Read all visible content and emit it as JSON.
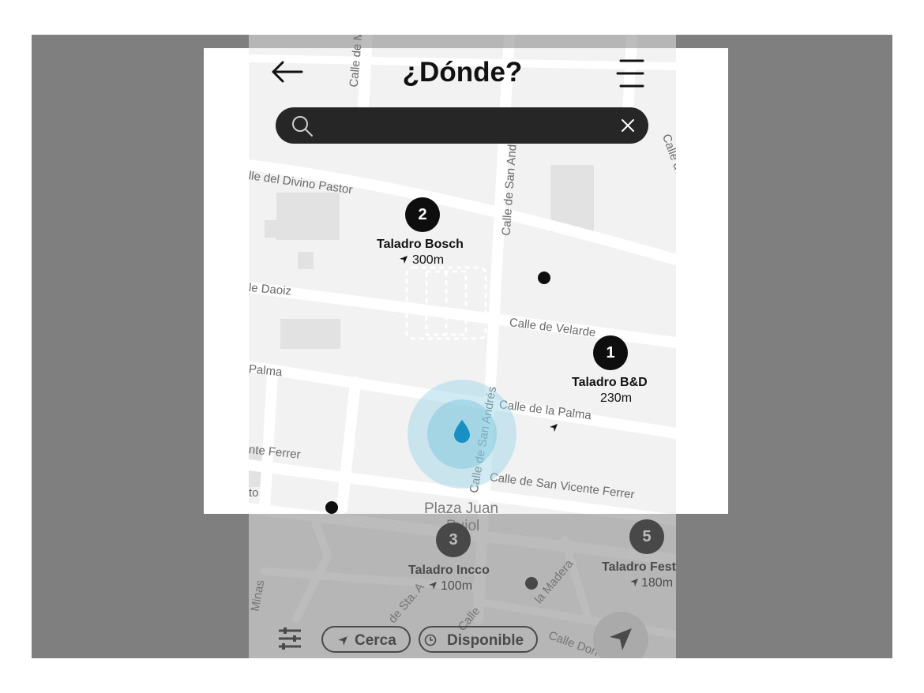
{
  "header": {
    "title": "¿Dónde?"
  },
  "search": {
    "placeholder": "",
    "value": ""
  },
  "icons": {
    "back": "back-arrow-icon",
    "menu": "menu-icon",
    "search": "search-icon",
    "clear": "close-icon",
    "filter": "sliders-icon",
    "nearby": "location-arrow-icon",
    "available": "clock-icon",
    "navigate": "navigation-arrow-icon",
    "user_location": "water-drop-icon"
  },
  "markers": [
    {
      "number": "2",
      "name": "Taladro Bosch",
      "distance": "300m"
    },
    {
      "number": "1",
      "name": "Taladro B&D",
      "distance": "230m"
    },
    {
      "number": "3",
      "name": "Taladro Incco",
      "distance": "100m"
    },
    {
      "number": "5",
      "name": "Taladro Fest",
      "distance": "180m"
    }
  ],
  "streets": {
    "s1": "Calle de Mo",
    "s2": "lle del Divino Pastor",
    "s3": "Calle de San Andrés",
    "s4": "Calle de Fuenc",
    "s5": "le Daoiz",
    "s6": "Calle de Velarde",
    "s7": "Palma",
    "s8": "Calle de la Palma",
    "s9": "Calle de San Andrés",
    "s10": "nte Ferrer",
    "s11": "Calle de San Vicente Ferrer",
    "s12": "to",
    "s13": "Plaza Juan",
    "s14": "Pujol",
    "s15": "Minas",
    "s16": "de Sta. A",
    "s17": "Calle",
    "s18": "la Madera",
    "s19": "Calle Don Fe"
  },
  "filters": {
    "nearby": "Cerca",
    "available": "Disponible"
  },
  "colors": {
    "accent_location": "#1a8fc4",
    "marker": "#0e0e0e",
    "search_bg": "#262626"
  }
}
